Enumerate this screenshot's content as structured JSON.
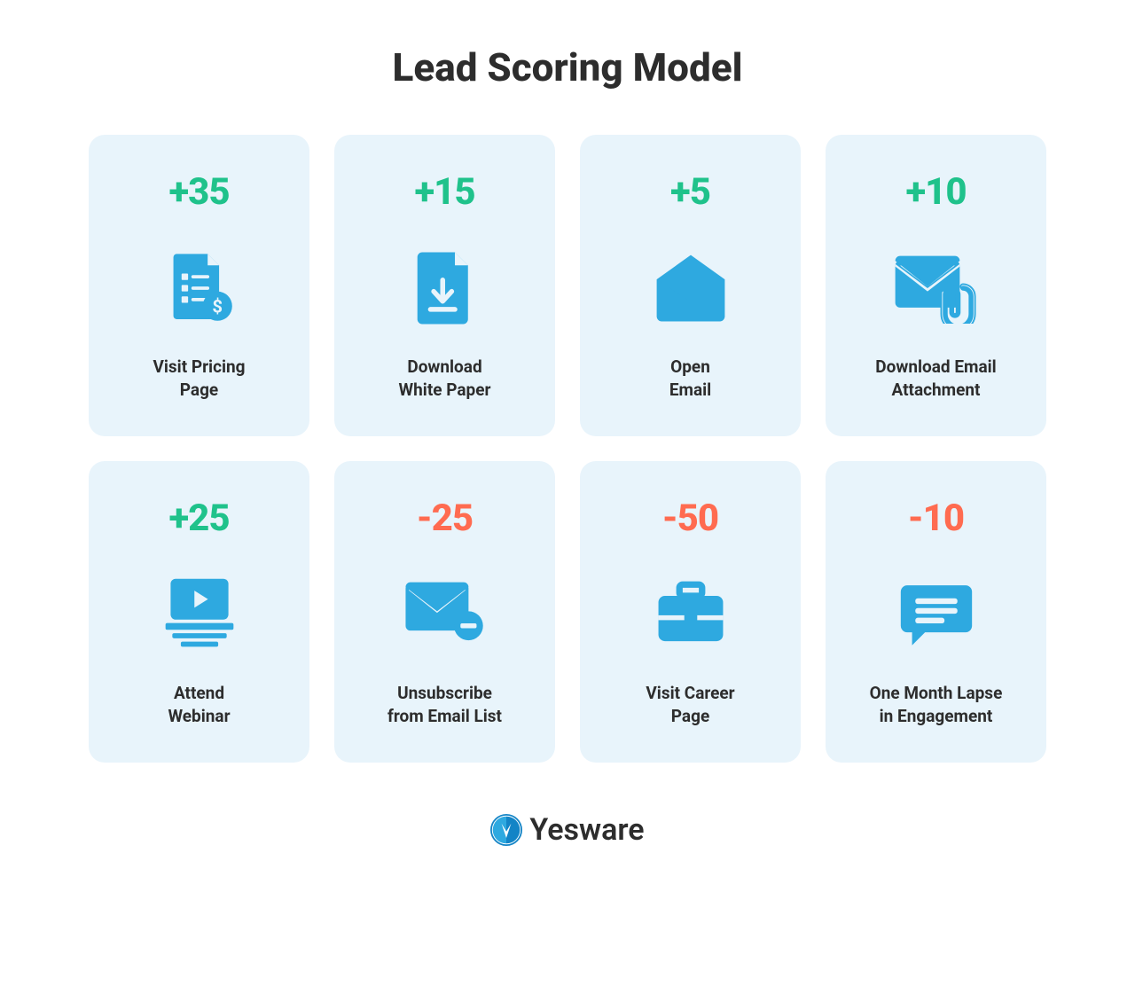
{
  "title": "Lead Scoring Model",
  "cards": [
    {
      "score": "+35",
      "positive": true,
      "icon": "document-dollar",
      "label": "Visit Pricing\nPage"
    },
    {
      "score": "+15",
      "positive": true,
      "icon": "document-download",
      "label": "Download\nWhite Paper"
    },
    {
      "score": "+5",
      "positive": true,
      "icon": "envelope-open",
      "label": "Open\nEmail"
    },
    {
      "score": "+10",
      "positive": true,
      "icon": "envelope-attachment",
      "label": "Download Email\nAttachment"
    },
    {
      "score": "+25",
      "positive": true,
      "icon": "webinar",
      "label": "Attend\nWebinar"
    },
    {
      "score": "-25",
      "positive": false,
      "icon": "envelope-minus",
      "label": "Unsubscribe\nfrom Email List"
    },
    {
      "score": "-50",
      "positive": false,
      "icon": "briefcase",
      "label": "Visit Career\nPage"
    },
    {
      "score": "-10",
      "positive": false,
      "icon": "chat",
      "label": "One Month Lapse\nin Engagement"
    }
  ],
  "brand": {
    "name": "Yesware"
  },
  "colors": {
    "positive": "#1fc28b",
    "negative": "#ff6b50",
    "icon": "#2ea9e0",
    "cardBg": "#e8f4fb"
  }
}
